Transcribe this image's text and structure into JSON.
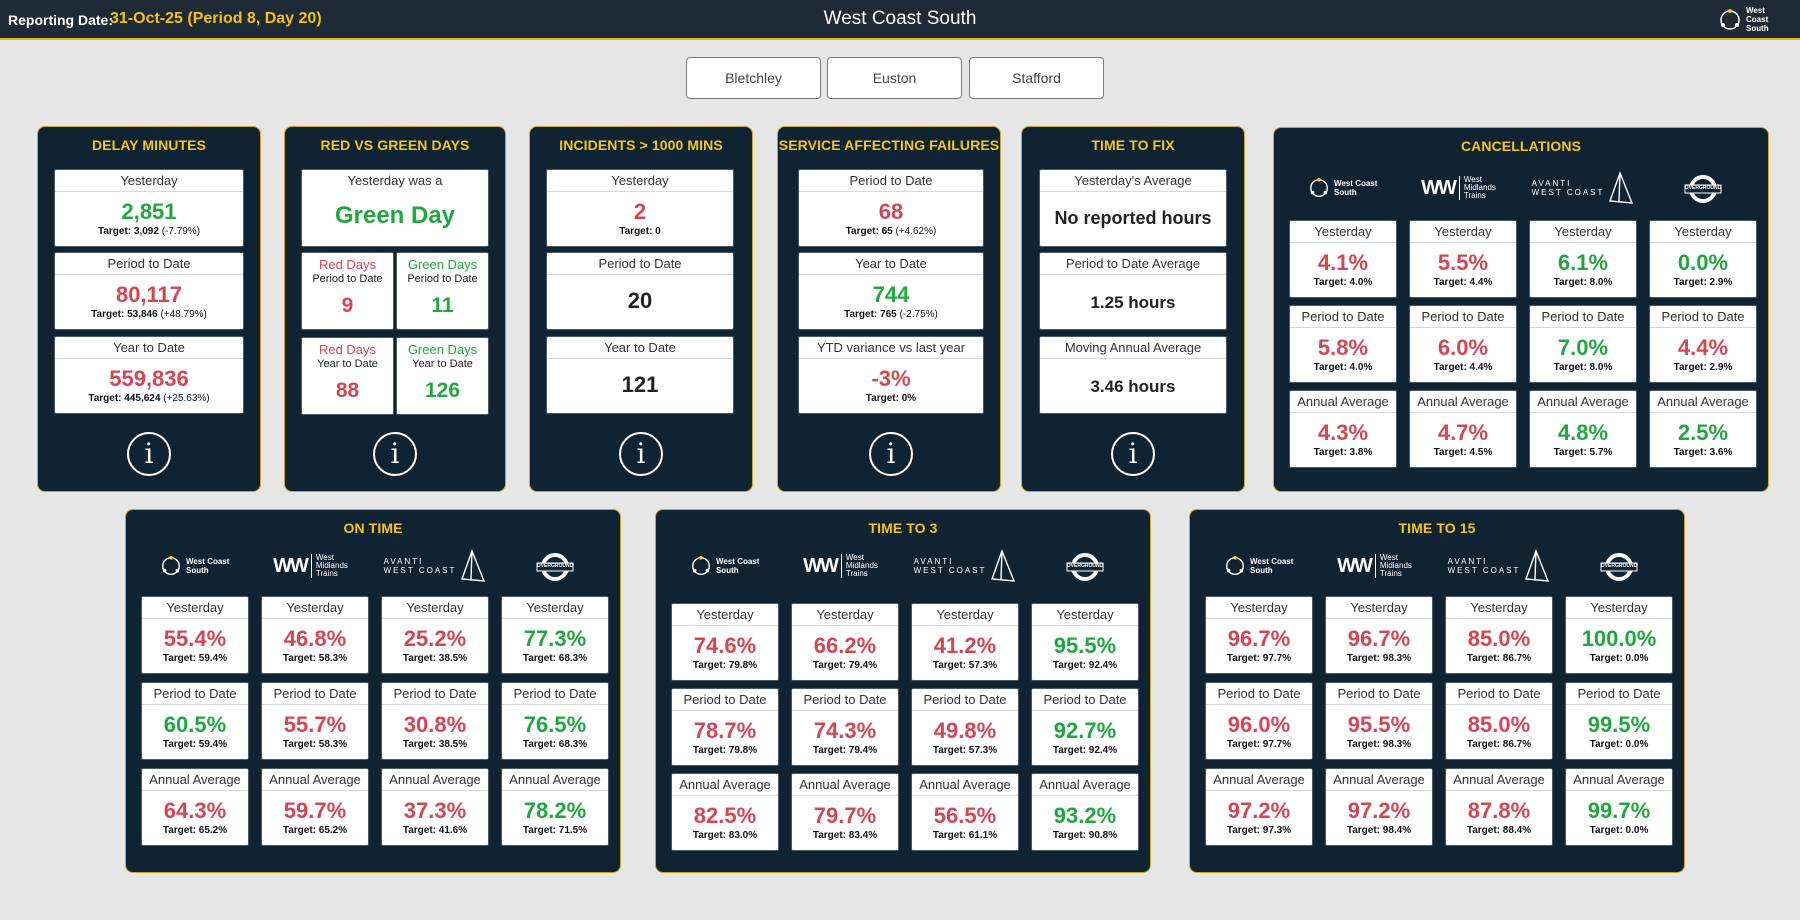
{
  "header": {
    "reporting_label": "Reporting Date:",
    "reporting_value": "31-Oct-25 (Period 8, Day 20)",
    "title": "West Coast South",
    "logo_text": "West Coast South"
  },
  "routes": [
    "Bletchley",
    "Euston",
    "Stafford"
  ],
  "logos": {
    "wcs": "West Coast South",
    "wmt_mark": "WW",
    "wmt": "West Midlands Trains",
    "avanti_top": "AVANTI",
    "avanti_bottom": "WEST COAST",
    "overground": "OVERGROUND"
  },
  "labels": {
    "yesterday": "Yesterday",
    "ptd": "Period to Date",
    "ytd": "Year to Date",
    "annual": "Annual Average"
  },
  "info_glyph": "i",
  "delay": {
    "title": "DELAY MINUTES",
    "yesterday": {
      "value": "2,851",
      "target": "Target: 3,092",
      "pct": "(-7.79%)"
    },
    "ptd": {
      "value": "80,117",
      "target": "Target: 53,846",
      "pct": "(+48.79%)"
    },
    "ytd": {
      "value": "559,836",
      "target": "Target: 445,624",
      "pct": "(+25.63%)"
    }
  },
  "redgreen": {
    "title": "RED VS GREEN DAYS",
    "yesterday_label": "Yesterday was a",
    "yesterday_value": "Green Day",
    "red_label": "Red Days",
    "green_label": "Green Days",
    "ptd_sub": "Period to Date",
    "ytd_sub": "Year to Date",
    "red_ptd": "9",
    "green_ptd": "11",
    "red_ytd": "88",
    "green_ytd": "126"
  },
  "incidents": {
    "title": "INCIDENTS > 1000 MINS",
    "yesterday": {
      "value": "2",
      "target": "Target: 0"
    },
    "ptd": {
      "value": "20"
    },
    "ytd": {
      "value": "121"
    }
  },
  "saf": {
    "title": "SERVICE AFFECTING FAILURES",
    "ptd": {
      "value": "68",
      "target": "Target: 65",
      "pct": "(+4.62%)"
    },
    "ytd": {
      "value": "744",
      "target": "Target: 765",
      "pct": "(-2.75%)"
    },
    "var_label": "YTD variance vs last year",
    "var": {
      "value": "-3%",
      "target": "Target: 0%"
    }
  },
  "ttf": {
    "title": "TIME TO FIX",
    "y_label": "Yesterday's Average",
    "y_value": "No reported hours",
    "p_label": "Period to Date Average",
    "p_value": "1.25 hours",
    "m_label": "Moving Annual Average",
    "m_value": "3.46 hours"
  },
  "cancel": {
    "title": "CANCELLATIONS",
    "cols": [
      {
        "y": "4.1%",
        "yt": "Target: 4.0%",
        "p": "5.8%",
        "pt": "Target: 4.0%",
        "a": "4.3%",
        "at": "Target: 3.8%"
      },
      {
        "y": "5.5%",
        "yt": "Target: 4.4%",
        "p": "6.0%",
        "pt": "Target: 4.4%",
        "a": "4.7%",
        "at": "Target: 4.5%"
      },
      {
        "y": "6.1%",
        "yt": "Target: 8.0%",
        "p": "7.0%",
        "pt": "Target: 8.0%",
        "a": "4.8%",
        "at": "Target: 5.7%"
      },
      {
        "y": "0.0%",
        "yt": "Target: 2.9%",
        "p": "4.4%",
        "pt": "Target: 2.9%",
        "a": "2.5%",
        "at": "Target: 3.6%"
      }
    ]
  },
  "ontime": {
    "title": "ON TIME",
    "cols": [
      {
        "y": "55.4%",
        "yt": "Target: 59.4%",
        "p": "60.5%",
        "pt": "Target: 59.4%",
        "a": "64.3%",
        "at": "Target: 65.2%"
      },
      {
        "y": "46.8%",
        "yt": "Target: 58.3%",
        "p": "55.7%",
        "pt": "Target: 58.3%",
        "a": "59.7%",
        "at": "Target: 65.2%"
      },
      {
        "y": "25.2%",
        "yt": "Target: 38.5%",
        "p": "30.8%",
        "pt": "Target: 38.5%",
        "a": "37.3%",
        "at": "Target: 41.6%"
      },
      {
        "y": "77.3%",
        "yt": "Target: 68.3%",
        "p": "76.5%",
        "pt": "Target: 68.3%",
        "a": "78.2%",
        "at": "Target: 71.5%"
      }
    ]
  },
  "t3": {
    "title": "TIME TO 3",
    "cols": [
      {
        "y": "74.6%",
        "yt": "Target: 79.8%",
        "p": "78.7%",
        "pt": "Target: 79.8%",
        "a": "82.5%",
        "at": "Target: 83.0%"
      },
      {
        "y": "66.2%",
        "yt": "Target: 79.4%",
        "p": "74.3%",
        "pt": "Target: 79.4%",
        "a": "79.7%",
        "at": "Target: 83.4%"
      },
      {
        "y": "41.2%",
        "yt": "Target: 57.3%",
        "p": "49.8%",
        "pt": "Target: 57.3%",
        "a": "56.5%",
        "at": "Target: 61.1%"
      },
      {
        "y": "95.5%",
        "yt": "Target: 92.4%",
        "p": "92.7%",
        "pt": "Target: 92.4%",
        "a": "93.2%",
        "at": "Target: 90.8%"
      }
    ]
  },
  "t15": {
    "title": "TIME TO 15",
    "cols": [
      {
        "y": "96.7%",
        "yt": "Target: 97.7%",
        "p": "96.0%",
        "pt": "Target: 97.7%",
        "a": "97.2%",
        "at": "Target: 97.3%"
      },
      {
        "y": "96.7%",
        "yt": "Target: 98.3%",
        "p": "95.5%",
        "pt": "Target: 98.3%",
        "a": "97.2%",
        "at": "Target: 98.4%"
      },
      {
        "y": "85.0%",
        "yt": "Target: 86.7%",
        "p": "85.0%",
        "pt": "Target: 86.7%",
        "a": "87.8%",
        "at": "Target: 88.4%"
      },
      {
        "y": "100.0%",
        "yt": "Target: 0.0%",
        "p": "99.5%",
        "pt": "Target: 0.0%",
        "a": "99.7%",
        "at": "Target: 0.0%"
      }
    ]
  },
  "colors": {
    "good": "#1fa83e",
    "bad": "#d94452",
    "accent": "#f5c518",
    "panel": "#0f2333"
  }
}
